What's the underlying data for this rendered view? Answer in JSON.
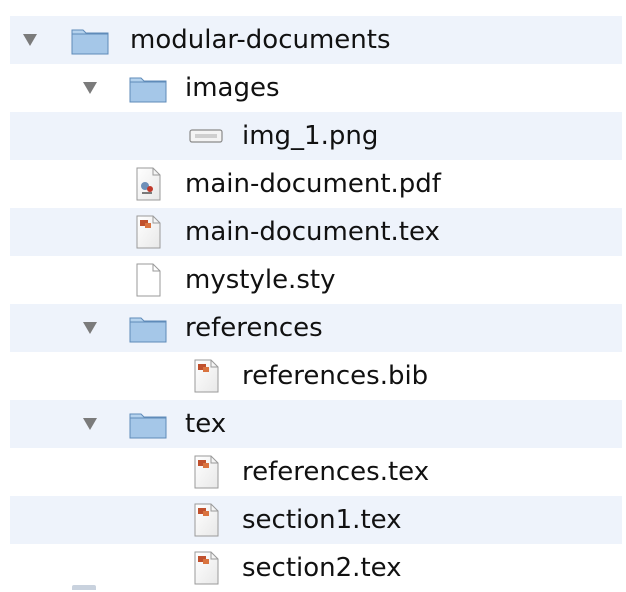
{
  "tree": {
    "items": [
      {
        "label": "modular-documents",
        "icon": "folder-icon",
        "depth": 0,
        "expanded": true
      },
      {
        "label": "images",
        "icon": "folder-icon",
        "depth": 1,
        "expanded": true
      },
      {
        "label": "img_1.png",
        "icon": "image-file-icon",
        "depth": 2
      },
      {
        "label": "main-document.pdf",
        "icon": "pdf-file-icon",
        "depth": 1
      },
      {
        "label": "main-document.tex",
        "icon": "tex-file-icon",
        "depth": 1
      },
      {
        "label": "mystyle.sty",
        "icon": "blank-file-icon",
        "depth": 1
      },
      {
        "label": "references",
        "icon": "folder-icon",
        "depth": 1,
        "expanded": true
      },
      {
        "label": "references.bib",
        "icon": "tex-file-icon",
        "depth": 2
      },
      {
        "label": "tex",
        "icon": "folder-icon",
        "depth": 1,
        "expanded": true
      },
      {
        "label": "references.tex",
        "icon": "tex-file-icon",
        "depth": 2
      },
      {
        "label": "section1.tex",
        "icon": "tex-file-icon",
        "depth": 2
      },
      {
        "label": "section2.tex",
        "icon": "tex-file-icon",
        "depth": 2
      }
    ]
  },
  "colors": {
    "row_alt": "#eef3fb",
    "folder": "#8fb8df",
    "text": "#111111"
  }
}
